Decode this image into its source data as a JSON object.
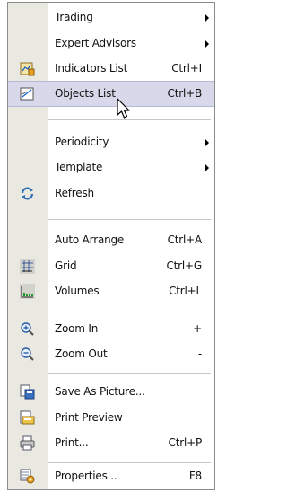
{
  "menu": {
    "items": [
      {
        "label": "Trading",
        "shortcut": "",
        "submenu": true,
        "icon": ""
      },
      {
        "label": "Expert Advisors",
        "shortcut": "",
        "submenu": true,
        "icon": ""
      },
      {
        "label": "Indicators List",
        "shortcut": "Ctrl+I",
        "submenu": false,
        "icon": "indicators-icon"
      },
      {
        "label": "Objects List",
        "shortcut": "Ctrl+B",
        "submenu": false,
        "icon": "objects-icon",
        "highlighted": true
      },
      {
        "label": "Periodicity",
        "shortcut": "",
        "submenu": true,
        "icon": ""
      },
      {
        "label": "Template",
        "shortcut": "",
        "submenu": true,
        "icon": ""
      },
      {
        "label": "Refresh",
        "shortcut": "",
        "submenu": false,
        "icon": "refresh-icon"
      },
      {
        "label": "Auto Arrange",
        "shortcut": "Ctrl+A",
        "submenu": false,
        "icon": ""
      },
      {
        "label": "Grid",
        "shortcut": "Ctrl+G",
        "submenu": false,
        "icon": "grid-icon"
      },
      {
        "label": "Volumes",
        "shortcut": "Ctrl+L",
        "submenu": false,
        "icon": "volumes-icon"
      },
      {
        "label": "Zoom In",
        "shortcut": "+",
        "submenu": false,
        "icon": "zoom-in-icon"
      },
      {
        "label": "Zoom Out",
        "shortcut": "-",
        "submenu": false,
        "icon": "zoom-out-icon"
      },
      {
        "label": "Save As Picture...",
        "shortcut": "",
        "submenu": false,
        "icon": "save-picture-icon"
      },
      {
        "label": "Print Preview",
        "shortcut": "",
        "submenu": false,
        "icon": "print-preview-icon"
      },
      {
        "label": "Print...",
        "shortcut": "Ctrl+P",
        "submenu": false,
        "icon": "printer-icon"
      },
      {
        "label": "Properties...",
        "shortcut": "F8",
        "submenu": false,
        "icon": "properties-icon"
      }
    ]
  },
  "colors": {
    "gutter": "#e9e9e2",
    "highlight": "#d7d8e9",
    "highlight_border": "#b5b7d6"
  }
}
